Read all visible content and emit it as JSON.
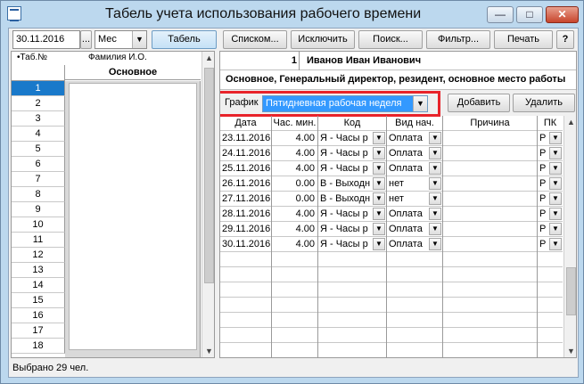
{
  "window": {
    "title": "Табель учета использования рабочего времени",
    "minimize_glyph": "—",
    "maximize_glyph": "□",
    "close_glyph": "✕"
  },
  "toolbar": {
    "date_value": "30.11.2016",
    "date_btn": "...",
    "period_value": "Мес",
    "tabel": "Табель",
    "list": "Списком...",
    "exclude": "Исключить",
    "search": "Поиск...",
    "filter": "Фильтр...",
    "print": "Печать",
    "help": "?"
  },
  "left": {
    "tab_header": "•Таб.№",
    "name_header": "Фамилия И.О.",
    "main_header": "Основное",
    "rows": [
      "1",
      "2",
      "3",
      "4",
      "5",
      "6",
      "7",
      "8",
      "9",
      "10",
      "11",
      "12",
      "13",
      "14",
      "15",
      "16",
      "17",
      "18"
    ],
    "selected_row": "1"
  },
  "employee": {
    "tab_no": "1",
    "name": "Иванов Иван Иванович",
    "position": "Основное, Генеральный директор, резидент, основное место работы"
  },
  "schedule": {
    "label": "График",
    "value": "Пятидневная рабочая неделя",
    "add": "Добавить",
    "delete": "Удалить"
  },
  "grid": {
    "headers": [
      "Дата",
      "Час. мин.",
      "Код",
      "Вид нач.",
      "Причина",
      "ПК"
    ],
    "rows": [
      {
        "date": "23.11.2016",
        "hours": "4.00",
        "code": "Я  - Часы р",
        "type": "Оплата",
        "reason": "",
        "pk": "Р"
      },
      {
        "date": "24.11.2016",
        "hours": "4.00",
        "code": "Я  - Часы р",
        "type": "Оплата",
        "reason": "",
        "pk": "Р"
      },
      {
        "date": "25.11.2016",
        "hours": "4.00",
        "code": "Я  - Часы р",
        "type": "Оплата",
        "reason": "",
        "pk": "Р"
      },
      {
        "date": "26.11.2016",
        "hours": "0.00",
        "code": "В  - Выходн",
        "type": "нет",
        "reason": "",
        "pk": "Р"
      },
      {
        "date": "27.11.2016",
        "hours": "0.00",
        "code": "В  - Выходн",
        "type": "нет",
        "reason": "",
        "pk": "Р"
      },
      {
        "date": "28.11.2016",
        "hours": "4.00",
        "code": "Я  - Часы р",
        "type": "Оплата",
        "reason": "",
        "pk": "Р"
      },
      {
        "date": "29.11.2016",
        "hours": "4.00",
        "code": "Я  - Часы р",
        "type": "Оплата",
        "reason": "",
        "pk": "Р"
      },
      {
        "date": "30.11.2016",
        "hours": "4.00",
        "code": "Я  - Часы р",
        "type": "Оплата",
        "reason": "",
        "pk": "Р"
      }
    ]
  },
  "status": {
    "text": "Выбрано 29 чел."
  },
  "icons": {
    "dropdown": "▼",
    "scroll_up": "▲",
    "scroll_down": "▼"
  },
  "colors": {
    "selection": "#1979ca",
    "highlight_frame": "#e8232a"
  }
}
